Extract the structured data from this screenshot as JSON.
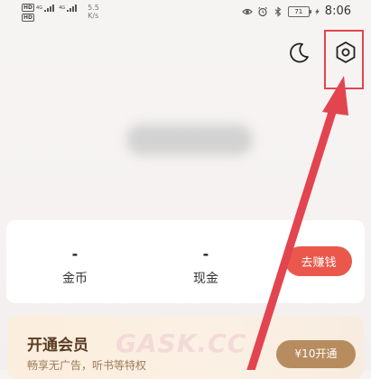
{
  "status_bar": {
    "sim1_badge": "HD",
    "sim1_network": "4G",
    "sim2_badge": "HD",
    "sim2_network": "4G",
    "net_speed_value": "5.5",
    "net_speed_unit": "K/s",
    "battery_level": "71",
    "time": "8:06"
  },
  "header": {
    "moon_icon": "moon-icon",
    "settings_icon": "gear-hexagon-icon"
  },
  "wallet": {
    "coins_value": "-",
    "coins_label": "金币",
    "cash_value": "-",
    "cash_label": "现金",
    "earn_button": "去赚钱"
  },
  "vip": {
    "title": "开通会员",
    "subtitle": "畅享无广告，听书等特权",
    "button": "¥10开通"
  },
  "watermark": "GASK.CC",
  "colors": {
    "accent_red": "#e9584b",
    "annotation_red": "#e2454f",
    "vip_gold": "#b78c5e"
  }
}
